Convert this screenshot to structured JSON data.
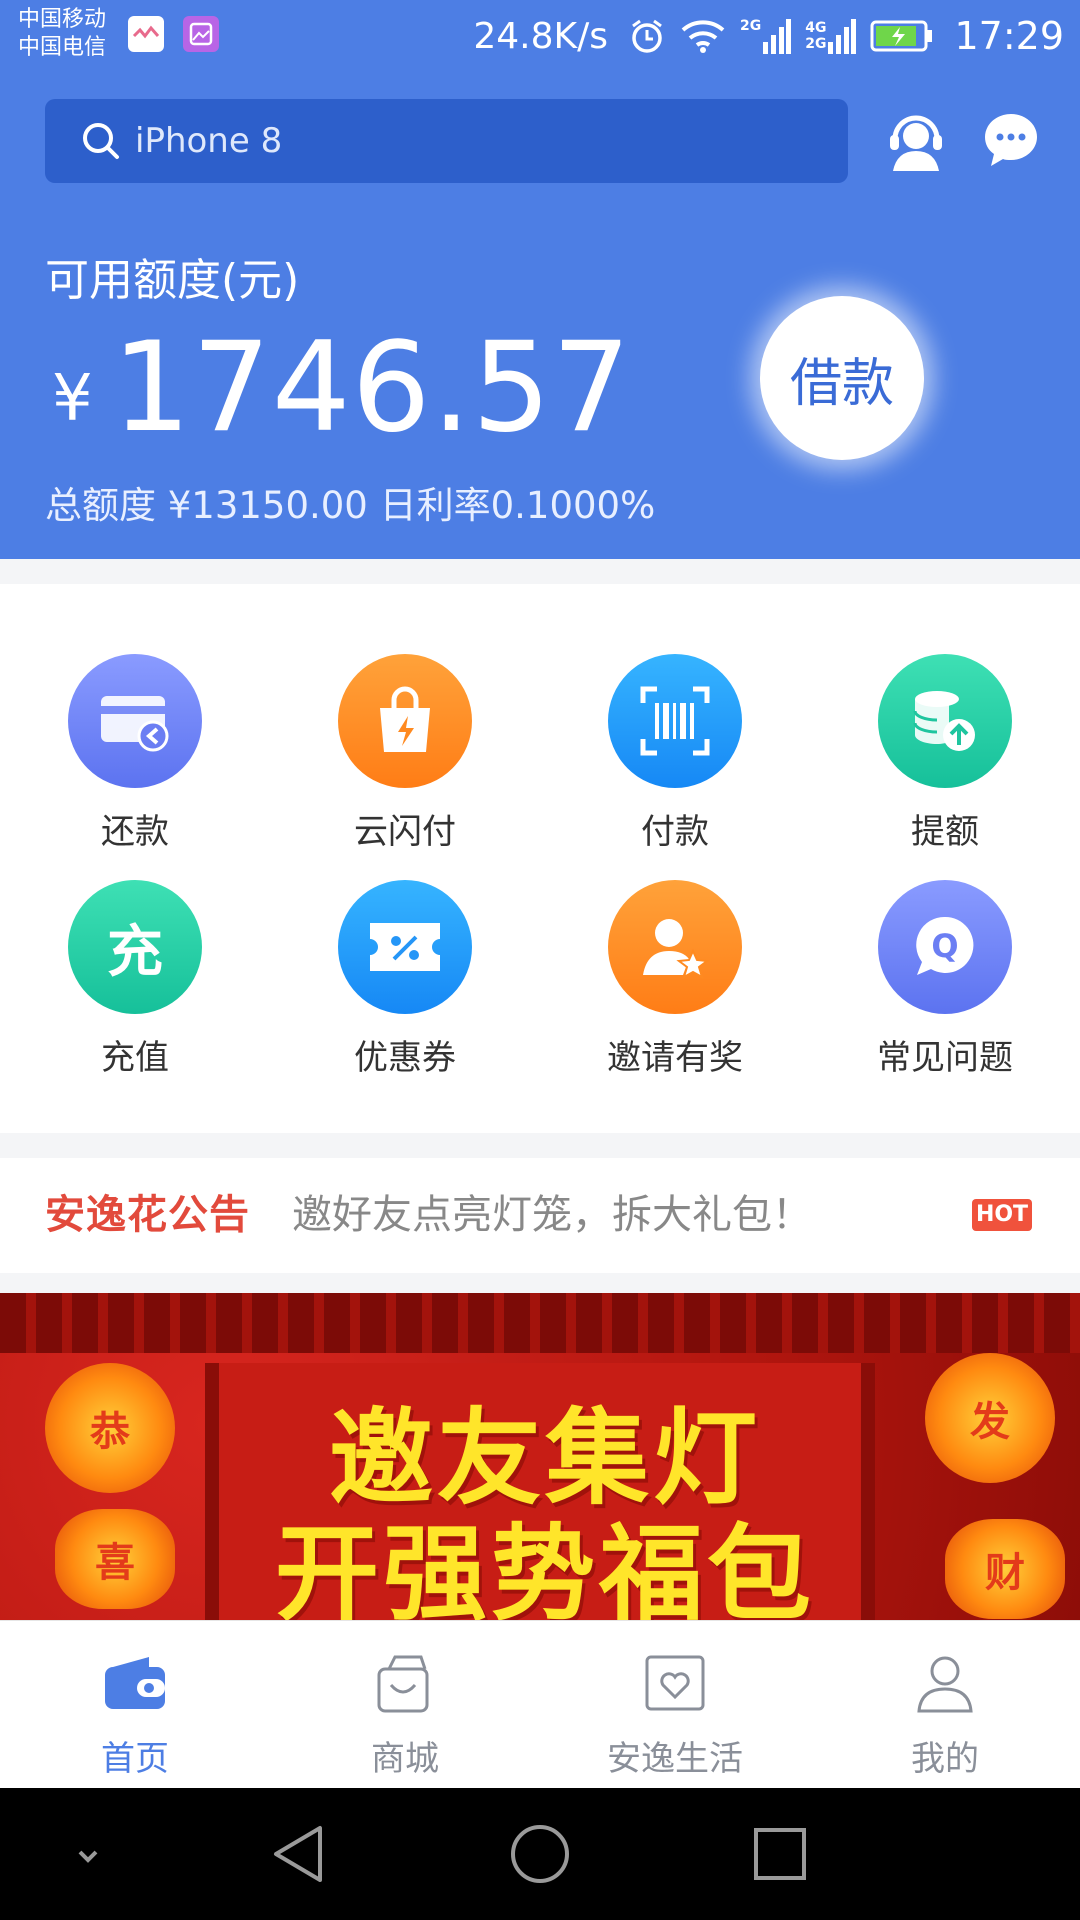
{
  "status_bar": {
    "carrier_1": "中国移动",
    "carrier_2": "中国电信",
    "net_speed": "24.8K/s",
    "sim1_type": "2G",
    "sim2_type_top": "4G",
    "sim2_type_bottom": "2G",
    "time": "17:29"
  },
  "search": {
    "placeholder": "iPhone 8"
  },
  "credit": {
    "available_label": "可用额度(元)",
    "currency_symbol": "¥",
    "available_amount": "1746.57",
    "borrow_button": "借款",
    "limit_info": "总额度 ¥13150.00  日利率0.1000%"
  },
  "grid": [
    {
      "label": "还款",
      "icon": "repay-card-icon",
      "color_top": "#8a9bff",
      "color_bottom": "#5c73f0"
    },
    {
      "label": "云闪付",
      "icon": "quickpay-bag-icon",
      "color_top": "#ffa23a",
      "color_bottom": "#ff7d16"
    },
    {
      "label": "付款",
      "icon": "barcode-scan-icon",
      "color_top": "#36b4ff",
      "color_bottom": "#1688f5"
    },
    {
      "label": "提额",
      "icon": "coin-stack-up-icon",
      "color_top": "#3ee0b4",
      "color_bottom": "#16c09a"
    },
    {
      "label": "充值",
      "icon": "recharge-icon",
      "color_top": "#3ee0b4",
      "color_bottom": "#16c09a",
      "glyph": "充"
    },
    {
      "label": "优惠券",
      "icon": "coupon-icon",
      "color_top": "#36b4ff",
      "color_bottom": "#1688f5"
    },
    {
      "label": "邀请有奖",
      "icon": "invite-star-icon",
      "color_top": "#ffa23a",
      "color_bottom": "#ff7d16"
    },
    {
      "label": "常见问题",
      "icon": "faq-bubble-icon",
      "color_top": "#8a9bff",
      "color_bottom": "#5c73f0"
    }
  ],
  "notice": {
    "brand": "安逸花公告",
    "text": "邀好友点亮灯笼，拆大礼包！",
    "badge": "HOT"
  },
  "banner": {
    "line1": "邀友集灯",
    "line2": "开强势福包",
    "lantern_left_top": "恭",
    "lantern_left_bottom": "喜",
    "lantern_right_top": "发",
    "lantern_right_bottom": "财"
  },
  "bottom_nav": [
    {
      "label": "首页",
      "icon": "wallet-icon",
      "active": true
    },
    {
      "label": "商城",
      "icon": "shopping-bag-icon",
      "active": false
    },
    {
      "label": "安逸生活",
      "icon": "heart-box-icon",
      "active": false
    },
    {
      "label": "我的",
      "icon": "person-icon",
      "active": false
    }
  ],
  "colors": {
    "header_blue": "#4d7ee4",
    "search_blue": "#2d5fcb",
    "accent_red": "#e24a3c",
    "nav_active": "#4d7ee4",
    "nav_inactive": "#8a8f99"
  }
}
